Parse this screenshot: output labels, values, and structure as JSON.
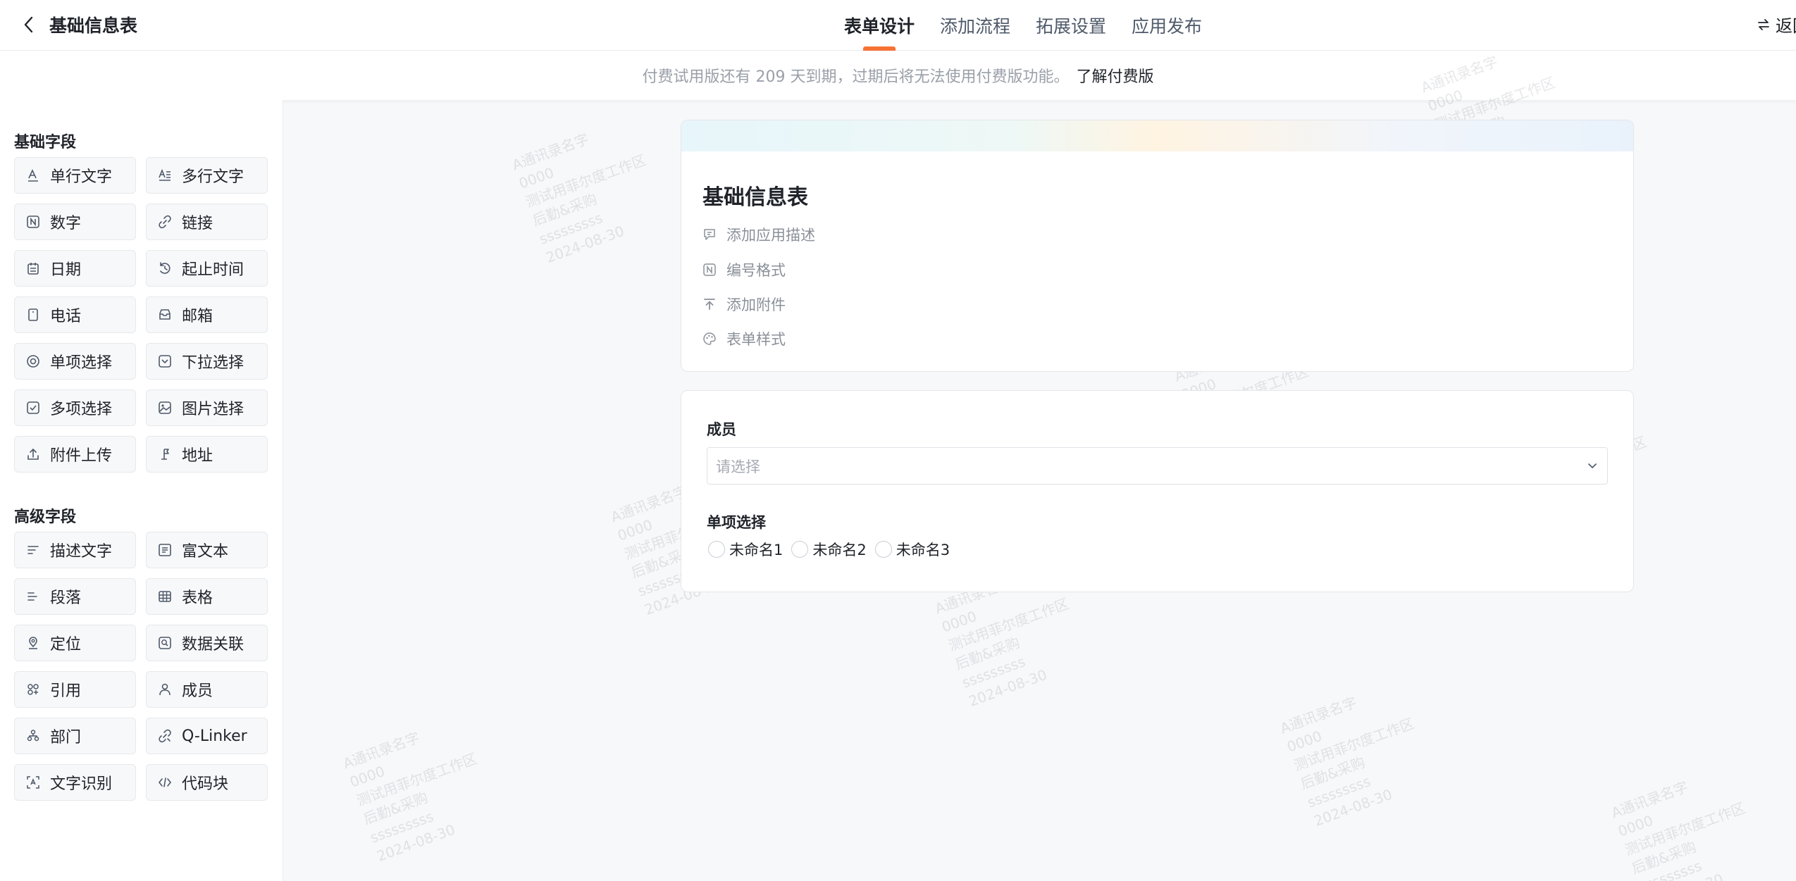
{
  "header": {
    "title": "基础信息表",
    "tabs": [
      {
        "label": "表单设计",
        "active": true
      },
      {
        "label": "添加流程",
        "active": false
      },
      {
        "label": "拓展设置",
        "active": false
      },
      {
        "label": "应用发布",
        "active": false
      }
    ],
    "return_label": "返回"
  },
  "notice": {
    "message": "付费试用版还有 209 天到期，过期后将无法使用付费版功能。",
    "link": "了解付费版"
  },
  "sidebar": {
    "basic_title": "基础字段",
    "basic_fields": [
      {
        "label": "单行文字",
        "icon": "single-line-text-icon"
      },
      {
        "label": "多行文字",
        "icon": "multi-line-text-icon"
      },
      {
        "label": "数字",
        "icon": "number-icon"
      },
      {
        "label": "链接",
        "icon": "link-icon"
      },
      {
        "label": "日期",
        "icon": "calendar-icon"
      },
      {
        "label": "起止时间",
        "icon": "time-range-icon"
      },
      {
        "label": "电话",
        "icon": "phone-icon"
      },
      {
        "label": "邮箱",
        "icon": "mail-icon"
      },
      {
        "label": "单项选择",
        "icon": "radio-icon"
      },
      {
        "label": "下拉选择",
        "icon": "dropdown-icon"
      },
      {
        "label": "多项选择",
        "icon": "checkbox-icon"
      },
      {
        "label": "图片选择",
        "icon": "image-icon"
      },
      {
        "label": "附件上传",
        "icon": "upload-icon"
      },
      {
        "label": "地址",
        "icon": "map-pin-icon"
      }
    ],
    "advanced_title": "高级字段",
    "advanced_fields": [
      {
        "label": "描述文字",
        "icon": "description-icon"
      },
      {
        "label": "富文本",
        "icon": "rich-text-icon"
      },
      {
        "label": "段落",
        "icon": "paragraph-icon"
      },
      {
        "label": "表格",
        "icon": "table-icon"
      },
      {
        "label": "定位",
        "icon": "location-icon"
      },
      {
        "label": "数据关联",
        "icon": "data-link-icon"
      },
      {
        "label": "引用",
        "icon": "reference-icon"
      },
      {
        "label": "成员",
        "icon": "user-icon"
      },
      {
        "label": "部门",
        "icon": "department-icon"
      },
      {
        "label": "Q-Linker",
        "icon": "q-linker-icon"
      },
      {
        "label": "文字识别",
        "icon": "ocr-icon"
      },
      {
        "label": "代码块",
        "icon": "code-icon"
      }
    ]
  },
  "form": {
    "title": "基础信息表",
    "options": [
      {
        "label": "添加应用描述",
        "icon": "comment-icon"
      },
      {
        "label": "编号格式",
        "icon": "number-format-icon"
      },
      {
        "label": "添加附件",
        "icon": "attachment-upload-icon"
      },
      {
        "label": "表单样式",
        "icon": "palette-icon"
      }
    ],
    "member_label": "成员",
    "member_placeholder": "请选择",
    "single_choice_label": "单项选择",
    "choices": [
      "未命名1",
      "未命名2",
      "未命名3"
    ]
  },
  "watermark": [
    "A通讯录名字",
    "0000",
    "测试用菲尔度工作区",
    "后勤&采购",
    "sssssssss",
    "2024-08-30"
  ]
}
